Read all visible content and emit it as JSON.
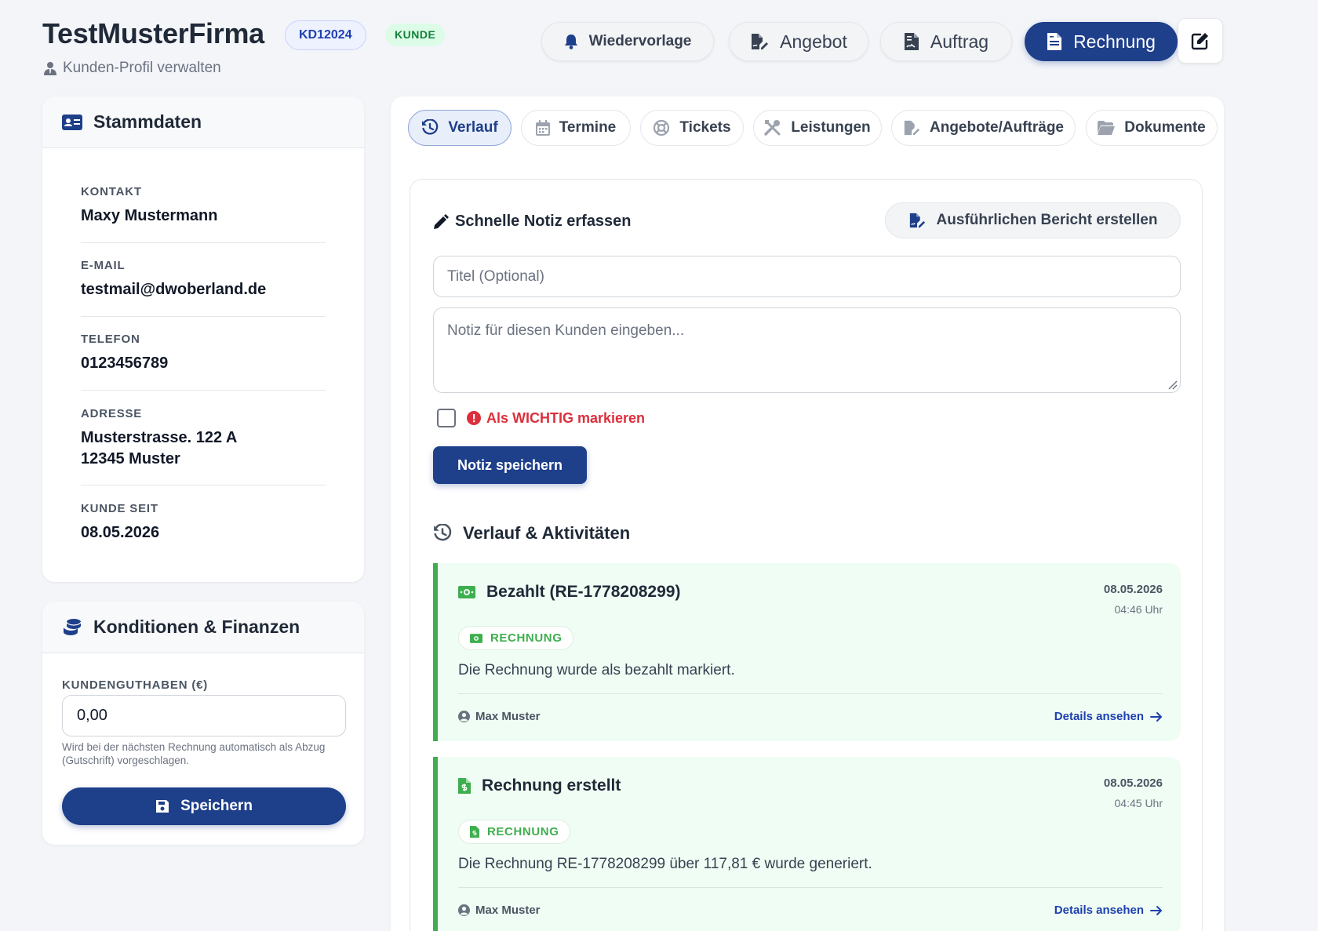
{
  "header": {
    "company_name": "TestMusterFirma",
    "customer_id": "KD12024",
    "customer_type": "KUNDE",
    "subtitle": "Kunden-Profil verwalten",
    "buttons": {
      "wiedervorlage": "Wiedervorlage",
      "angebot": "Angebot",
      "auftrag": "Auftrag",
      "rechnung": "Rechnung"
    }
  },
  "stammdaten": {
    "title": "Stammdaten",
    "fields": [
      {
        "label": "KONTAKT",
        "value": "Maxy Mustermann"
      },
      {
        "label": "E-MAIL",
        "value": "testmail@dwoberland.de"
      },
      {
        "label": "TELEFON",
        "value": "0123456789"
      },
      {
        "label": "ADRESSE",
        "value_line1": "Musterstrasse. 122 A",
        "value_line2": "12345 Muster"
      },
      {
        "label": "KUNDE SEIT",
        "value": "08.05.2026"
      }
    ]
  },
  "finanzen": {
    "title": "Konditionen & Finanzen",
    "guthaben_label": "KUNDENGUTHABEN (€)",
    "guthaben_value": "0,00",
    "hint": "Wird bei der nächsten Rechnung automatisch als Abzug (Gutschrift) vorgeschlagen.",
    "save_label": "Speichern"
  },
  "tabs": [
    {
      "label": "Verlauf",
      "active": true
    },
    {
      "label": "Termine"
    },
    {
      "label": "Tickets"
    },
    {
      "label": "Leistungen"
    },
    {
      "label": "Angebote/Aufträge"
    },
    {
      "label": "Dokumente"
    }
  ],
  "note": {
    "title": "Schnelle Notiz erfassen",
    "report_button": "Ausführlichen Bericht erstellen",
    "title_placeholder": "Titel (Optional)",
    "text_placeholder": "Notiz für diesen Kunden eingeben...",
    "important_label": "Als WICHTIG markieren",
    "save_label": "Notiz speichern"
  },
  "history": {
    "title": "Verlauf & Aktivitäten",
    "entries": [
      {
        "title": "Bezahlt (RE-1778208299)",
        "date": "08.05.2026",
        "time": "04:46 Uhr",
        "badge": "RECHNUNG",
        "text": "Die Rechnung wurde als bezahlt markiert.",
        "user": "Max Muster",
        "link": "Details ansehen"
      },
      {
        "title": "Rechnung erstellt",
        "date": "08.05.2026",
        "time": "04:45 Uhr",
        "badge": "RECHNUNG",
        "text": "Die Rechnung RE-1778208299 über 117,81 € wurde generiert.",
        "user": "Max Muster",
        "link": "Details ansehen"
      }
    ]
  },
  "colors": {
    "primary": "#1e3f8a",
    "success": "#3fae4f",
    "danger": "#dc2f3c",
    "background": "#f3f5f9"
  }
}
